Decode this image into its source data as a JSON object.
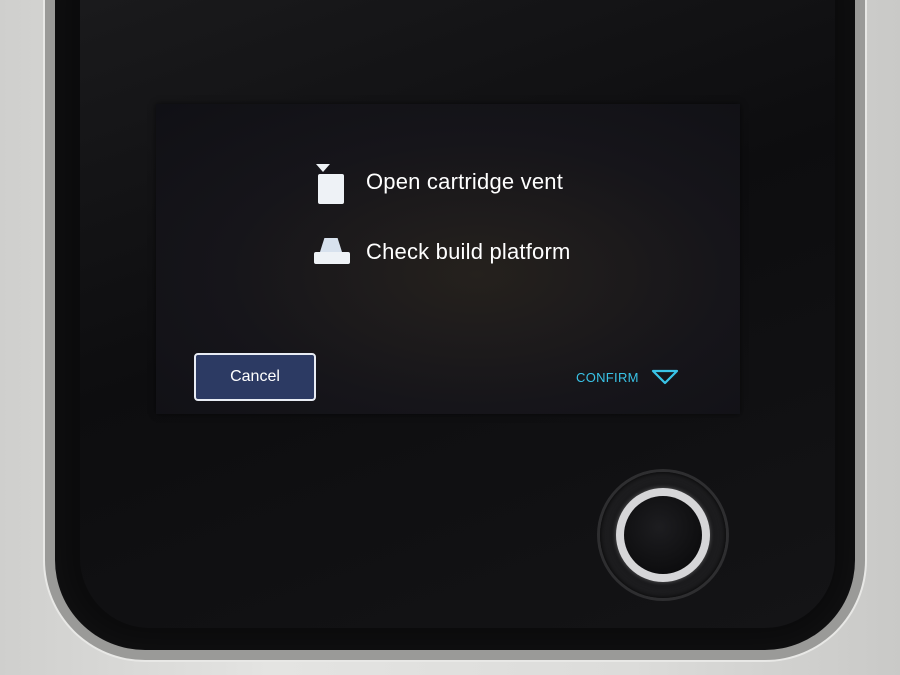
{
  "menu": {
    "items": [
      {
        "label": "Open cartridge vent",
        "icon": "cartridge-vent-icon"
      },
      {
        "label": "Check build platform",
        "icon": "build-platform-icon"
      }
    ]
  },
  "actions": {
    "cancel_label": "Cancel",
    "confirm_label": "CONFIRM",
    "confirm_icon": "chevron-down-icon"
  },
  "colors": {
    "cancel_bg": "#2c3a63",
    "confirm_accent": "#39c3e6",
    "text": "#ffffff"
  }
}
